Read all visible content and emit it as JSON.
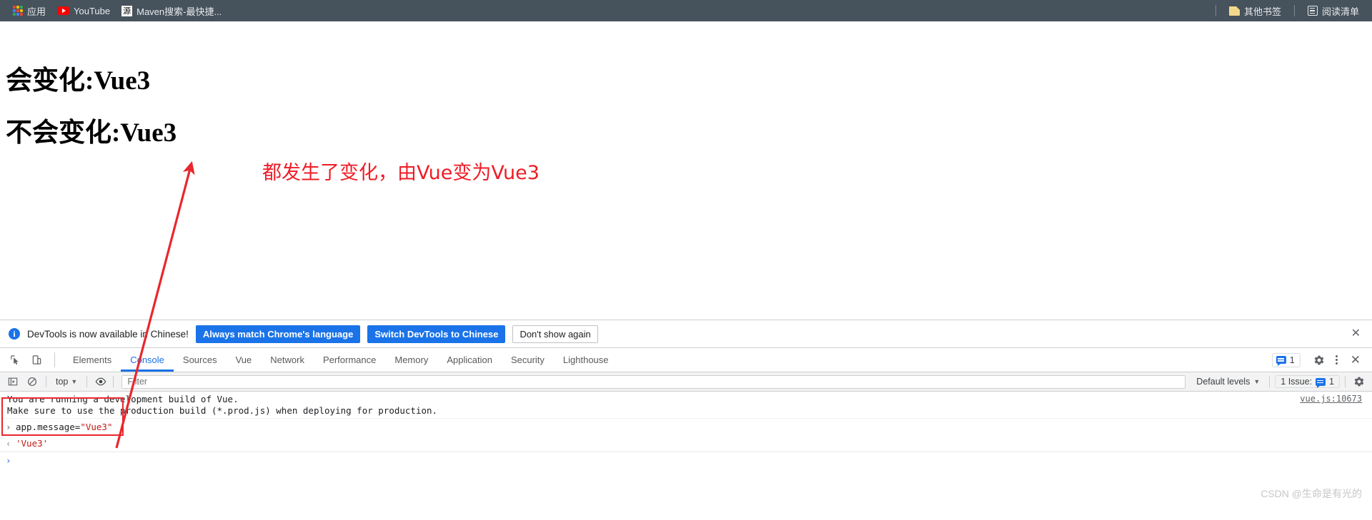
{
  "browser": {
    "bookmarks": [
      {
        "label": "应用",
        "icon": "apps-grid-icon"
      },
      {
        "label": "YouTube",
        "icon": "youtube-icon"
      },
      {
        "label": "Maven搜索-最快捷...",
        "icon": "maven-favicon"
      }
    ],
    "right_items": [
      {
        "label": "其他书签",
        "icon": "folder-icon"
      },
      {
        "label": "阅读清单",
        "icon": "reading-list-icon"
      }
    ],
    "maven_glyph": "源"
  },
  "page": {
    "heading_changing": "会变化:Vue3",
    "heading_static": "不会变化:Vue3",
    "annotation": "都发生了变化，由Vue变为Vue3",
    "annotation_color": "#ef1c25"
  },
  "devtools": {
    "notice": {
      "icon": "info-icon",
      "text": "DevTools is now available in Chinese!",
      "buttons": [
        {
          "label": "Always match Chrome's language",
          "style": "primary"
        },
        {
          "label": "Switch DevTools to Chinese",
          "style": "primary"
        },
        {
          "label": "Don't show again",
          "style": "plain"
        }
      ],
      "close": "✕"
    },
    "tabs": [
      {
        "label": "Elements",
        "active": false
      },
      {
        "label": "Console",
        "active": true
      },
      {
        "label": "Sources",
        "active": false
      },
      {
        "label": "Vue",
        "active": false
      },
      {
        "label": "Network",
        "active": false
      },
      {
        "label": "Performance",
        "active": false
      },
      {
        "label": "Memory",
        "active": false
      },
      {
        "label": "Application",
        "active": false
      },
      {
        "label": "Security",
        "active": false
      },
      {
        "label": "Lighthouse",
        "active": false
      }
    ],
    "tabbar_right": {
      "message_count": "1",
      "close": "✕"
    },
    "console_toolbar": {
      "context": "top",
      "filter_placeholder": "Filter",
      "filter_value": "",
      "levels": "Default levels",
      "issues_label": "1 Issue:",
      "issues_count": "1"
    },
    "console_messages": [
      {
        "line1": "You are running a development build of Vue.",
        "line2": "Make sure to use the production build (*.prod.js) when deploying for production.",
        "source": "vue.js:10673"
      }
    ],
    "console_input": {
      "prompt": "›",
      "expression_prefix": "app.message=",
      "expression_value": "\"Vue3\"",
      "return_prompt": "‹",
      "return_value": "'Vue3'",
      "empty_prompt": "›"
    },
    "accent_blue": "#1a73e8"
  },
  "watermark": "CSDN @生命是有光的"
}
